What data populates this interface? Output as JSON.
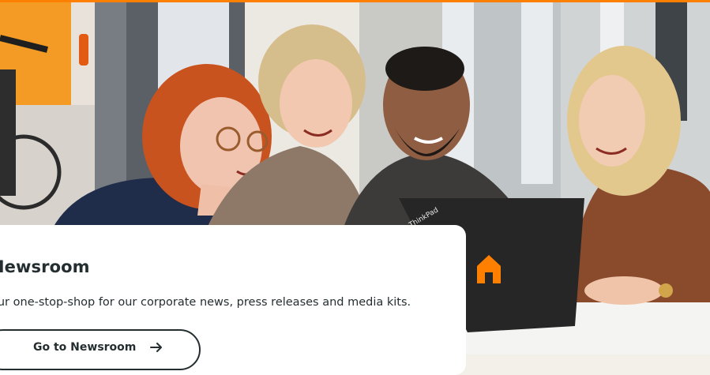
{
  "hero": {
    "image_description": "four people smiling at a laptop",
    "laptop_logo_icon": "orange-house-logo-icon",
    "laptop_brand": "ThinkPad"
  },
  "newsroom_card": {
    "title": "Newsroom",
    "description": "our one-stop-shop for our corporate news, press releases and media kits.",
    "button_label": "Go to Newsroom",
    "button_icon": "arrow-right-icon"
  },
  "colors": {
    "accent": "#ff8000",
    "text": "#242e30",
    "card_bg": "#ffffff"
  }
}
